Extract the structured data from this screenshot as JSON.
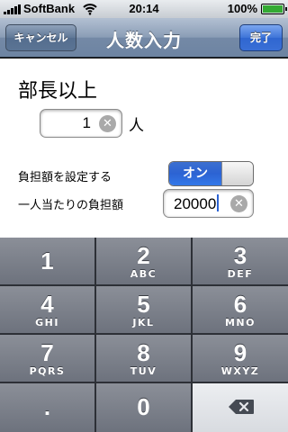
{
  "status_bar": {
    "carrier": "SoftBank",
    "time": "20:14",
    "battery_percent": "100%",
    "signal_icon": "signal-bars-icon",
    "wifi_icon": "wifi-icon",
    "battery_icon": "battery-full-icon"
  },
  "nav_bar": {
    "title": "人数入力",
    "cancel_label": "キャンセル",
    "done_label": "完了"
  },
  "form": {
    "heading": "部長以上",
    "count_value": "1",
    "count_unit": "人",
    "setting_label": "負担額を設定する",
    "toggle_on_label": "オン",
    "toggle_state": "on",
    "amount_label": "一人当たりの負担額",
    "amount_value": "20000"
  },
  "keypad": {
    "keys": [
      {
        "num": "1",
        "letters": ""
      },
      {
        "num": "2",
        "letters": "ABC"
      },
      {
        "num": "3",
        "letters": "DEF"
      },
      {
        "num": "4",
        "letters": "GHI"
      },
      {
        "num": "5",
        "letters": "JKL"
      },
      {
        "num": "6",
        "letters": "MNO"
      },
      {
        "num": "7",
        "letters": "PQRS"
      },
      {
        "num": "8",
        "letters": "TUV"
      },
      {
        "num": "9",
        "letters": "WXYZ"
      },
      {
        "num": ".",
        "letters": ""
      },
      {
        "num": "0",
        "letters": ""
      }
    ],
    "backspace_icon": "backspace-icon"
  },
  "colors": {
    "nav_blue": "#6d84a2",
    "done_blue": "#2f66d0",
    "toggle_blue": "#2c63d3",
    "keypad_key": "#7a7f89"
  }
}
